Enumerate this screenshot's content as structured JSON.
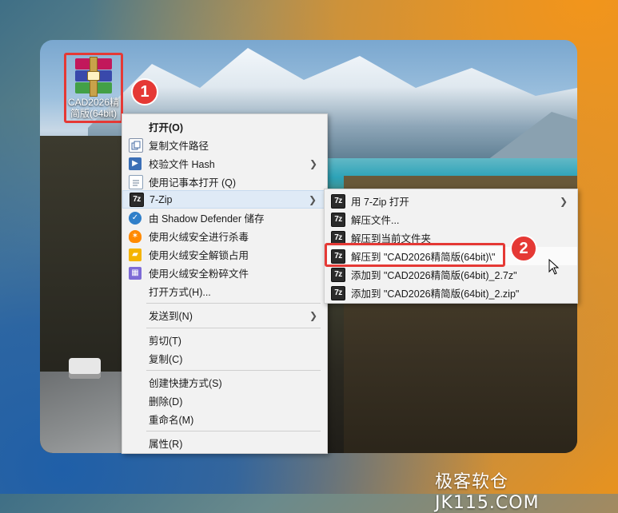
{
  "desktop": {
    "file_icon": {
      "icon": "winrar-archive-icon",
      "label": "CAD2026精简版(64bit)"
    },
    "step_badges": [
      "1",
      "2"
    ]
  },
  "context_menu": {
    "items": [
      {
        "label": "打开(O)",
        "icon": "none",
        "bold": true
      },
      {
        "label": "复制文件路径",
        "icon": "copy-path-icon"
      },
      {
        "label": "校验文件 Hash",
        "icon": "hash-icon",
        "submenu": true
      },
      {
        "label": "使用记事本打开 (Q)",
        "icon": "notepad-icon"
      },
      {
        "label": "7-Zip",
        "icon": "7zip-icon",
        "submenu": true,
        "highlighted": true
      },
      {
        "label": "由 Shadow Defender 储存",
        "icon": "shield-icon"
      },
      {
        "label": "使用火绒安全进行杀毒",
        "icon": "huorong-icon"
      },
      {
        "label": "使用火绒安全解锁占用",
        "icon": "folder-unlock-icon"
      },
      {
        "label": "使用火绒安全粉碎文件",
        "icon": "shredder-icon"
      },
      {
        "label": "打开方式(H)...",
        "icon": "none"
      },
      {
        "label": "发送到(N)",
        "icon": "none",
        "submenu": true
      },
      {
        "label": "剪切(T)",
        "icon": "none"
      },
      {
        "label": "复制(C)",
        "icon": "none"
      },
      {
        "label": "创建快捷方式(S)",
        "icon": "none"
      },
      {
        "label": "删除(D)",
        "icon": "none"
      },
      {
        "label": "重命名(M)",
        "icon": "none"
      },
      {
        "label": "属性(R)",
        "icon": "none"
      }
    ]
  },
  "submenu_7zip": {
    "items": [
      {
        "label": "用 7-Zip 打开",
        "submenu": true
      },
      {
        "label": "解压文件..."
      },
      {
        "label": "解压到当前文件夹"
      },
      {
        "label": "解压到 \"CAD2026精简版(64bit)\\\"",
        "highlighted": true
      },
      {
        "label": "添加到 \"CAD2026精简版(64bit)_2.7z\""
      },
      {
        "label": "添加到 \"CAD2026精简版(64bit)_2.zip\""
      }
    ],
    "icon_text": "7z"
  },
  "watermark": "极客软仓 JK115.COM",
  "colors": {
    "highlight_red": "#e53935",
    "menu_bg": "#f2f2f2",
    "menu_hover": "#dfeaf6"
  }
}
